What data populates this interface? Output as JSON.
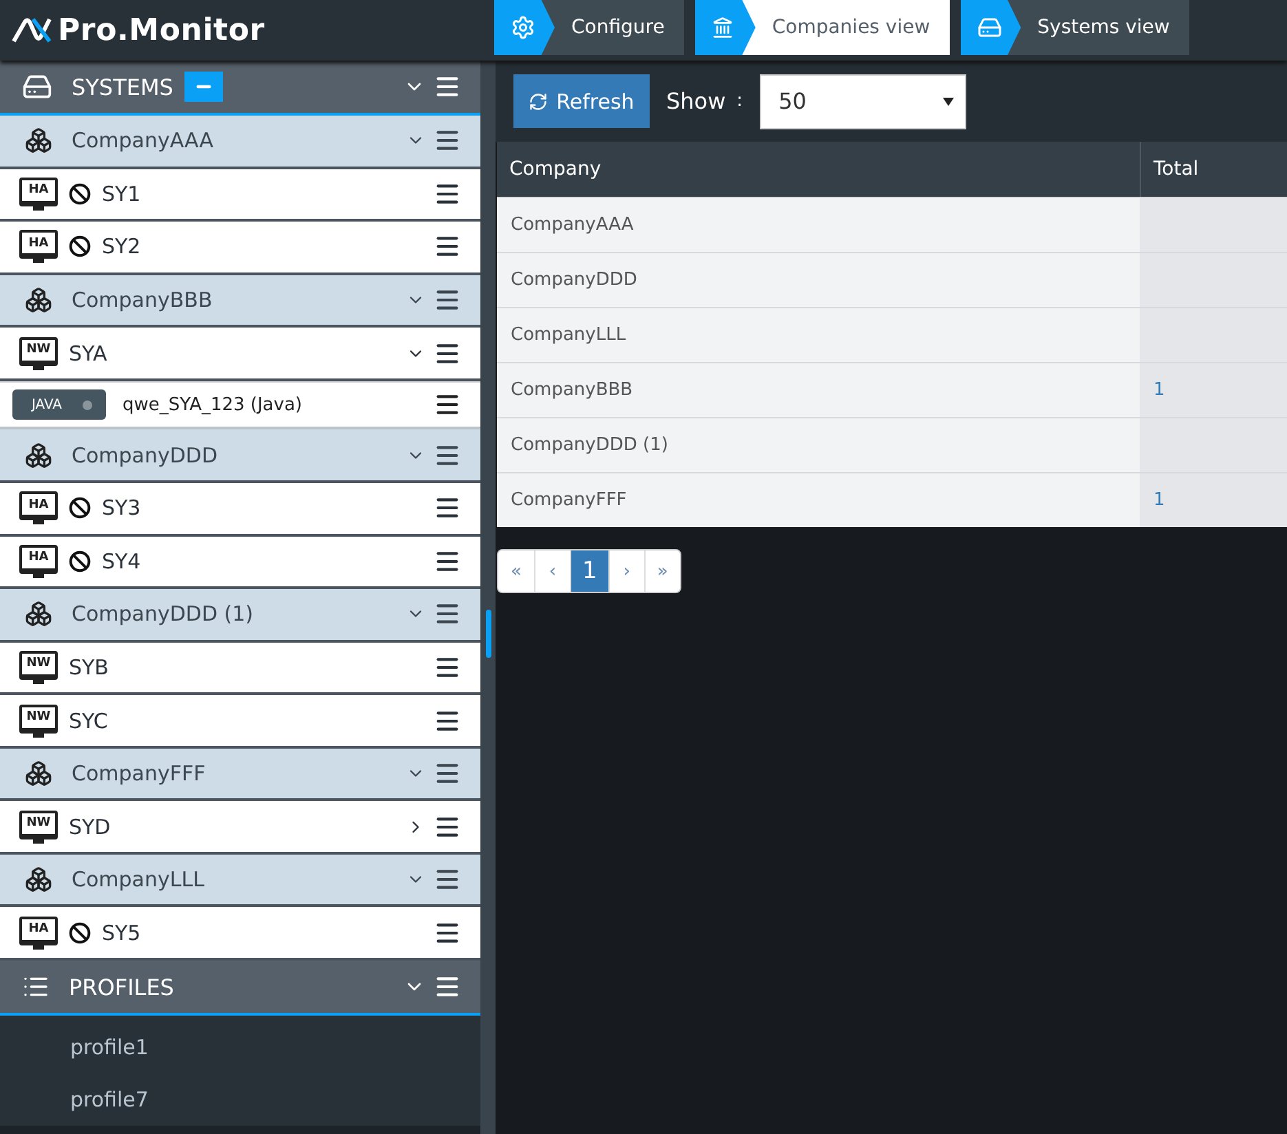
{
  "logo": {
    "text": "Pro.Monitor"
  },
  "nav_tabs": [
    {
      "label": "Configure",
      "selected": false
    },
    {
      "label": "Companies view",
      "selected": true
    },
    {
      "label": "Systems view",
      "selected": false
    }
  ],
  "sidebar": {
    "systems": {
      "title": "SYSTEMS",
      "expanded": true,
      "companies": [
        {
          "name": "CompanyAAA",
          "expanded": true,
          "systems": [
            {
              "type": "HA",
              "name": "SY1",
              "disabled": true,
              "kind": "leaf"
            },
            {
              "type": "HA",
              "name": "SY2",
              "disabled": true,
              "kind": "leaf"
            }
          ]
        },
        {
          "name": "CompanyBBB",
          "expanded": true,
          "systems": [
            {
              "type": "NW",
              "name": "SYA",
              "disabled": false,
              "kind": "branch",
              "expanded": true,
              "children": [
                {
                  "badge": "JAVA",
                  "name": "qwe_SYA_123 (Java)"
                }
              ]
            }
          ]
        },
        {
          "name": "CompanyDDD",
          "expanded": true,
          "systems": [
            {
              "type": "HA",
              "name": "SY3",
              "disabled": true,
              "kind": "leaf"
            },
            {
              "type": "HA",
              "name": "SY4",
              "disabled": true,
              "kind": "leaf"
            }
          ]
        },
        {
          "name": "CompanyDDD (1)",
          "expanded": true,
          "systems": [
            {
              "type": "NW",
              "name": "SYB",
              "disabled": false,
              "kind": "leaf"
            },
            {
              "type": "NW",
              "name": "SYC",
              "disabled": false,
              "kind": "leaf"
            }
          ]
        },
        {
          "name": "CompanyFFF",
          "expanded": true,
          "systems": [
            {
              "type": "NW",
              "name": "SYD",
              "disabled": false,
              "kind": "branch",
              "expanded": false
            }
          ]
        },
        {
          "name": "CompanyLLL",
          "expanded": true,
          "systems": [
            {
              "type": "HA",
              "name": "SY5",
              "disabled": true,
              "kind": "leaf"
            }
          ]
        }
      ]
    },
    "profiles": {
      "title": "PROFILES",
      "expanded": true,
      "items": [
        "profile1",
        "profile7"
      ]
    }
  },
  "toolbar": {
    "refresh": "Refresh",
    "show_label": "Show",
    "show_sep": ":",
    "show_value": "50"
  },
  "table": {
    "columns": [
      "Company",
      "Total"
    ],
    "rows": [
      {
        "company": "CompanyAAA"
      },
      {
        "company": "CompanyDDD"
      },
      {
        "company": "CompanyLLL"
      },
      {
        "company": "CompanyBBB",
        "total": "1"
      },
      {
        "company": "CompanyDDD (1)"
      },
      {
        "company": "CompanyFFF",
        "total": "1"
      }
    ]
  },
  "pagination": [
    {
      "label": "«",
      "selected": false
    },
    {
      "label": "‹",
      "selected": false
    },
    {
      "label": "1",
      "selected": true
    },
    {
      "label": "›",
      "selected": false
    },
    {
      "label": "»",
      "selected": false
    }
  ]
}
